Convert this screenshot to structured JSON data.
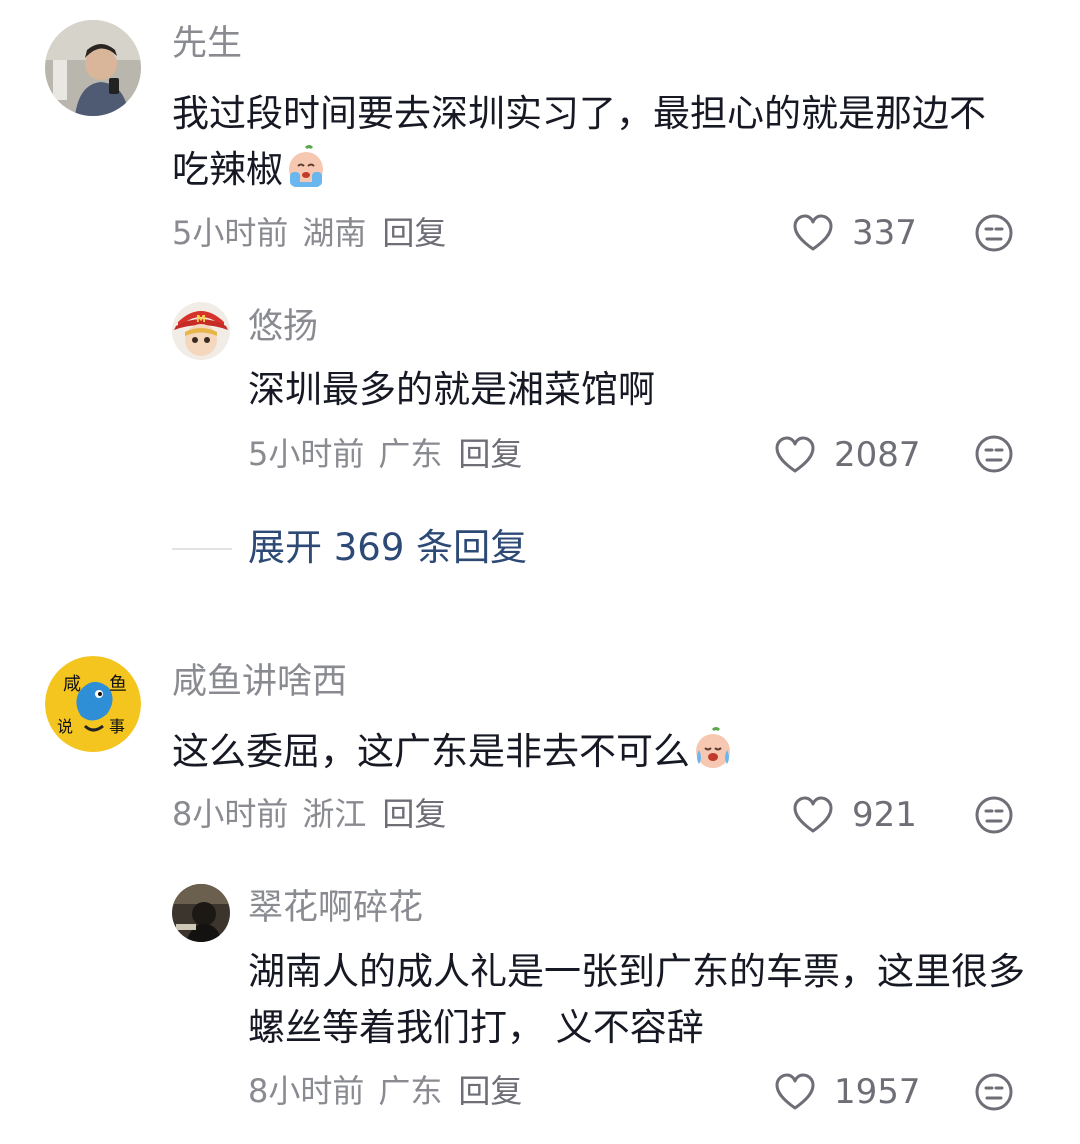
{
  "comments": [
    {
      "username": "先生",
      "text": "我过段时间要去深圳实习了，最担心的就是那边不吃辣椒",
      "emoji": "crying-face-emoji",
      "time": "5小时前",
      "location": "湖南",
      "reply_label": "回复",
      "likes": "337",
      "replies": [
        {
          "username": "悠扬",
          "text": "深圳最多的就是湘菜馆啊",
          "time": "5小时前",
          "location": "广东",
          "reply_label": "回复",
          "likes": "2087"
        }
      ],
      "expand_label": "展开 369 条回复"
    },
    {
      "username": "咸鱼讲啥西",
      "text": "这么委屈，这广东是非去不可么",
      "emoji": "crying-face-emoji",
      "time": "8小时前",
      "location": "浙江",
      "reply_label": "回复",
      "likes": "921",
      "avatar_text": [
        "咸",
        "鱼",
        "说",
        "事"
      ],
      "replies": [
        {
          "username": "翠花啊碎花",
          "text": "湖南人的成人礼是一张到广东的车票，这里很多螺丝等着我们打， 义不容辞",
          "time": "8小时前",
          "location": "广东",
          "reply_label": "回复",
          "likes": "1957"
        }
      ]
    }
  ],
  "colors": {
    "text_primary": "#161823",
    "text_secondary": "#8a8b91",
    "expand_link": "#2c4a75",
    "avatar_yellow": "#f4c51f"
  }
}
